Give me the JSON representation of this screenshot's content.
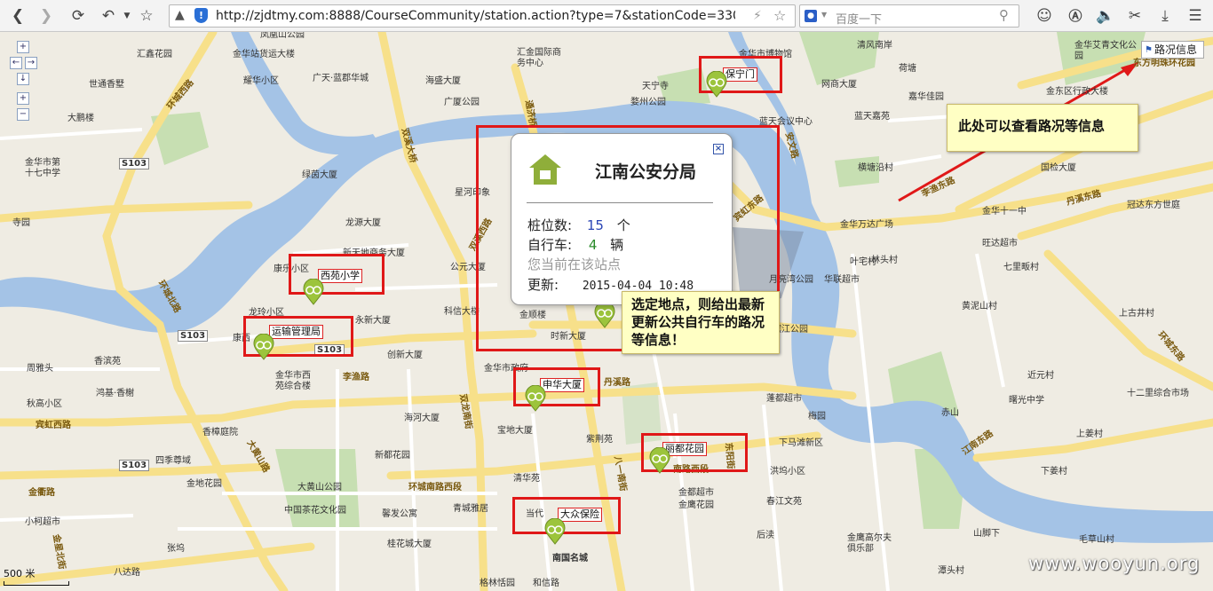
{
  "browser": {
    "url": "http://zjdtmy.com:8888/CourseCommunity/station.action?type=7&stationCode=3307230",
    "search_placeholder": "百度一下"
  },
  "map": {
    "traffic_button": "路况信息",
    "scale_label": "500 米",
    "watermark": "www.wooyun.org",
    "labels": [
      {
        "text": "凤凰山公园"
      },
      {
        "text": "汇鑫花园"
      },
      {
        "text": "金华站货运大楼"
      },
      {
        "text": "耀华小区"
      },
      {
        "text": "广天·蓝郡华城"
      },
      {
        "text": "世通香墅"
      },
      {
        "text": "大鹏楼"
      },
      {
        "text": "金华市第十七中学"
      },
      {
        "text": "寺园"
      },
      {
        "text": "海盛大厦"
      },
      {
        "text": "广厦公园"
      },
      {
        "text": "汇金国际商务中心"
      },
      {
        "text": "金华市博物馆"
      },
      {
        "text": "清风南岸"
      },
      {
        "text": "天宁寺"
      },
      {
        "text": "婺州公园"
      },
      {
        "text": "网商大厦"
      },
      {
        "text": "荷塘"
      },
      {
        "text": "嘉华佳园"
      },
      {
        "text": "蓝天会议中心"
      },
      {
        "text": "蓝天嘉苑"
      },
      {
        "text": "金华艾青文化公园"
      },
      {
        "text": "金东区行政大楼"
      },
      {
        "text": "横塘沿村"
      },
      {
        "text": "国检大厦"
      },
      {
        "text": "冠达东方世庭"
      },
      {
        "text": "金华十一中"
      },
      {
        "text": "金华万达广场"
      },
      {
        "text": "旺达超市"
      },
      {
        "text": "林头村"
      },
      {
        "text": "七里畈村"
      },
      {
        "text": "绿茵大厦"
      },
      {
        "text": "星河印象"
      },
      {
        "text": "龙源大厦"
      },
      {
        "text": "新天地商务大厦"
      },
      {
        "text": "康乐小区"
      },
      {
        "text": "公元大厦"
      },
      {
        "text": "龙玲小区"
      },
      {
        "text": "永新大厦"
      },
      {
        "text": "康西"
      },
      {
        "text": "科信大楼"
      },
      {
        "text": "金顺楼"
      },
      {
        "text": "时新大厦"
      },
      {
        "text": "创新大厦"
      },
      {
        "text": "金华市政府"
      },
      {
        "text": "香滨苑"
      },
      {
        "text": "周雅头"
      },
      {
        "text": "鸿基·香榭"
      },
      {
        "text": "秋高小区"
      },
      {
        "text": "金华市西苑综合楼"
      },
      {
        "text": "海河大厦"
      },
      {
        "text": "宝地大厦"
      },
      {
        "text": "紫荆苑"
      },
      {
        "text": "新都花园"
      },
      {
        "text": "清华苑"
      },
      {
        "text": "香樟庭院"
      },
      {
        "text": "四季尊域"
      },
      {
        "text": "金地花园"
      },
      {
        "text": "大黄山公园"
      },
      {
        "text": "中国茶花文化园"
      },
      {
        "text": "馨发公寓"
      },
      {
        "text": "青城雅居"
      },
      {
        "text": "当代"
      },
      {
        "text": "桂花城大厦"
      },
      {
        "text": "张坞"
      },
      {
        "text": "小柯超市"
      },
      {
        "text": "南国名城"
      },
      {
        "text": "金都超市"
      },
      {
        "text": "金鹰花园"
      },
      {
        "text": "春江文苑"
      },
      {
        "text": "洪坞小区"
      },
      {
        "text": "下马滩新区"
      },
      {
        "text": "梅园"
      },
      {
        "text": "后渎"
      },
      {
        "text": "金鹰高尔夫俱乐部"
      },
      {
        "text": "山脚下"
      },
      {
        "text": "毛草山村"
      },
      {
        "text": "潭头村"
      },
      {
        "text": "赤山"
      },
      {
        "text": "上姜村"
      },
      {
        "text": "下姜村"
      },
      {
        "text": "曙光中学"
      },
      {
        "text": "十二里综合市场"
      },
      {
        "text": "近元村"
      },
      {
        "text": "上古井村"
      },
      {
        "text": "黄泥山村"
      },
      {
        "text": "华联超市"
      },
      {
        "text": "月亮湾公园"
      },
      {
        "text": "滨江公园"
      },
      {
        "text": "叶宅村"
      },
      {
        "text": "格林恬园"
      },
      {
        "text": "和信路"
      },
      {
        "text": "八达路"
      },
      {
        "text": "蓬都超市"
      }
    ],
    "roads": [
      {
        "text": "环城西路"
      },
      {
        "text": "环城北路"
      },
      {
        "text": "双龙南街"
      },
      {
        "text": "双溪西路"
      },
      {
        "text": "李渔路"
      },
      {
        "text": "丹溪路"
      },
      {
        "text": "环城南路西段"
      },
      {
        "text": "南路西段"
      },
      {
        "text": "八一南街"
      },
      {
        "text": "宾虹西路"
      },
      {
        "text": "金衢路"
      },
      {
        "text": "宾虹东路"
      },
      {
        "text": "李渔东路"
      },
      {
        "text": "丹溪东路"
      },
      {
        "text": "东阳街"
      },
      {
        "text": "环城东路"
      },
      {
        "text": "双溪大桥"
      },
      {
        "text": "通济桥"
      },
      {
        "text": "安文路"
      },
      {
        "text": "东方明珠环花园"
      },
      {
        "text": "S103"
      },
      {
        "text": "S103"
      },
      {
        "text": "S103"
      },
      {
        "text": "S103"
      },
      {
        "text": "大黄山路"
      },
      {
        "text": "江南东路"
      },
      {
        "text": "金星北街"
      }
    ],
    "stations": [
      {
        "name": "保宁门"
      },
      {
        "name": "西苑小学"
      },
      {
        "name": "运输管理局"
      },
      {
        "name": "申华大厦"
      },
      {
        "name": "丽都花园"
      },
      {
        "name": "大众保险"
      }
    ],
    "popup": {
      "title": "江南公安分局",
      "pile_label": "桩位数:",
      "pile_value": "15",
      "pile_unit": "个",
      "bike_label": "自行车:",
      "bike_value": "4",
      "bike_unit": "辆",
      "current_note": "您当前在该站点",
      "update_label": "更新:",
      "update_value": "2015-04-04 10:48"
    },
    "notes": {
      "traffic_note": "此处可以查看路况等信息",
      "select_note": "选定地点，则给出最新更新公共自行车的路况等信息！"
    }
  }
}
